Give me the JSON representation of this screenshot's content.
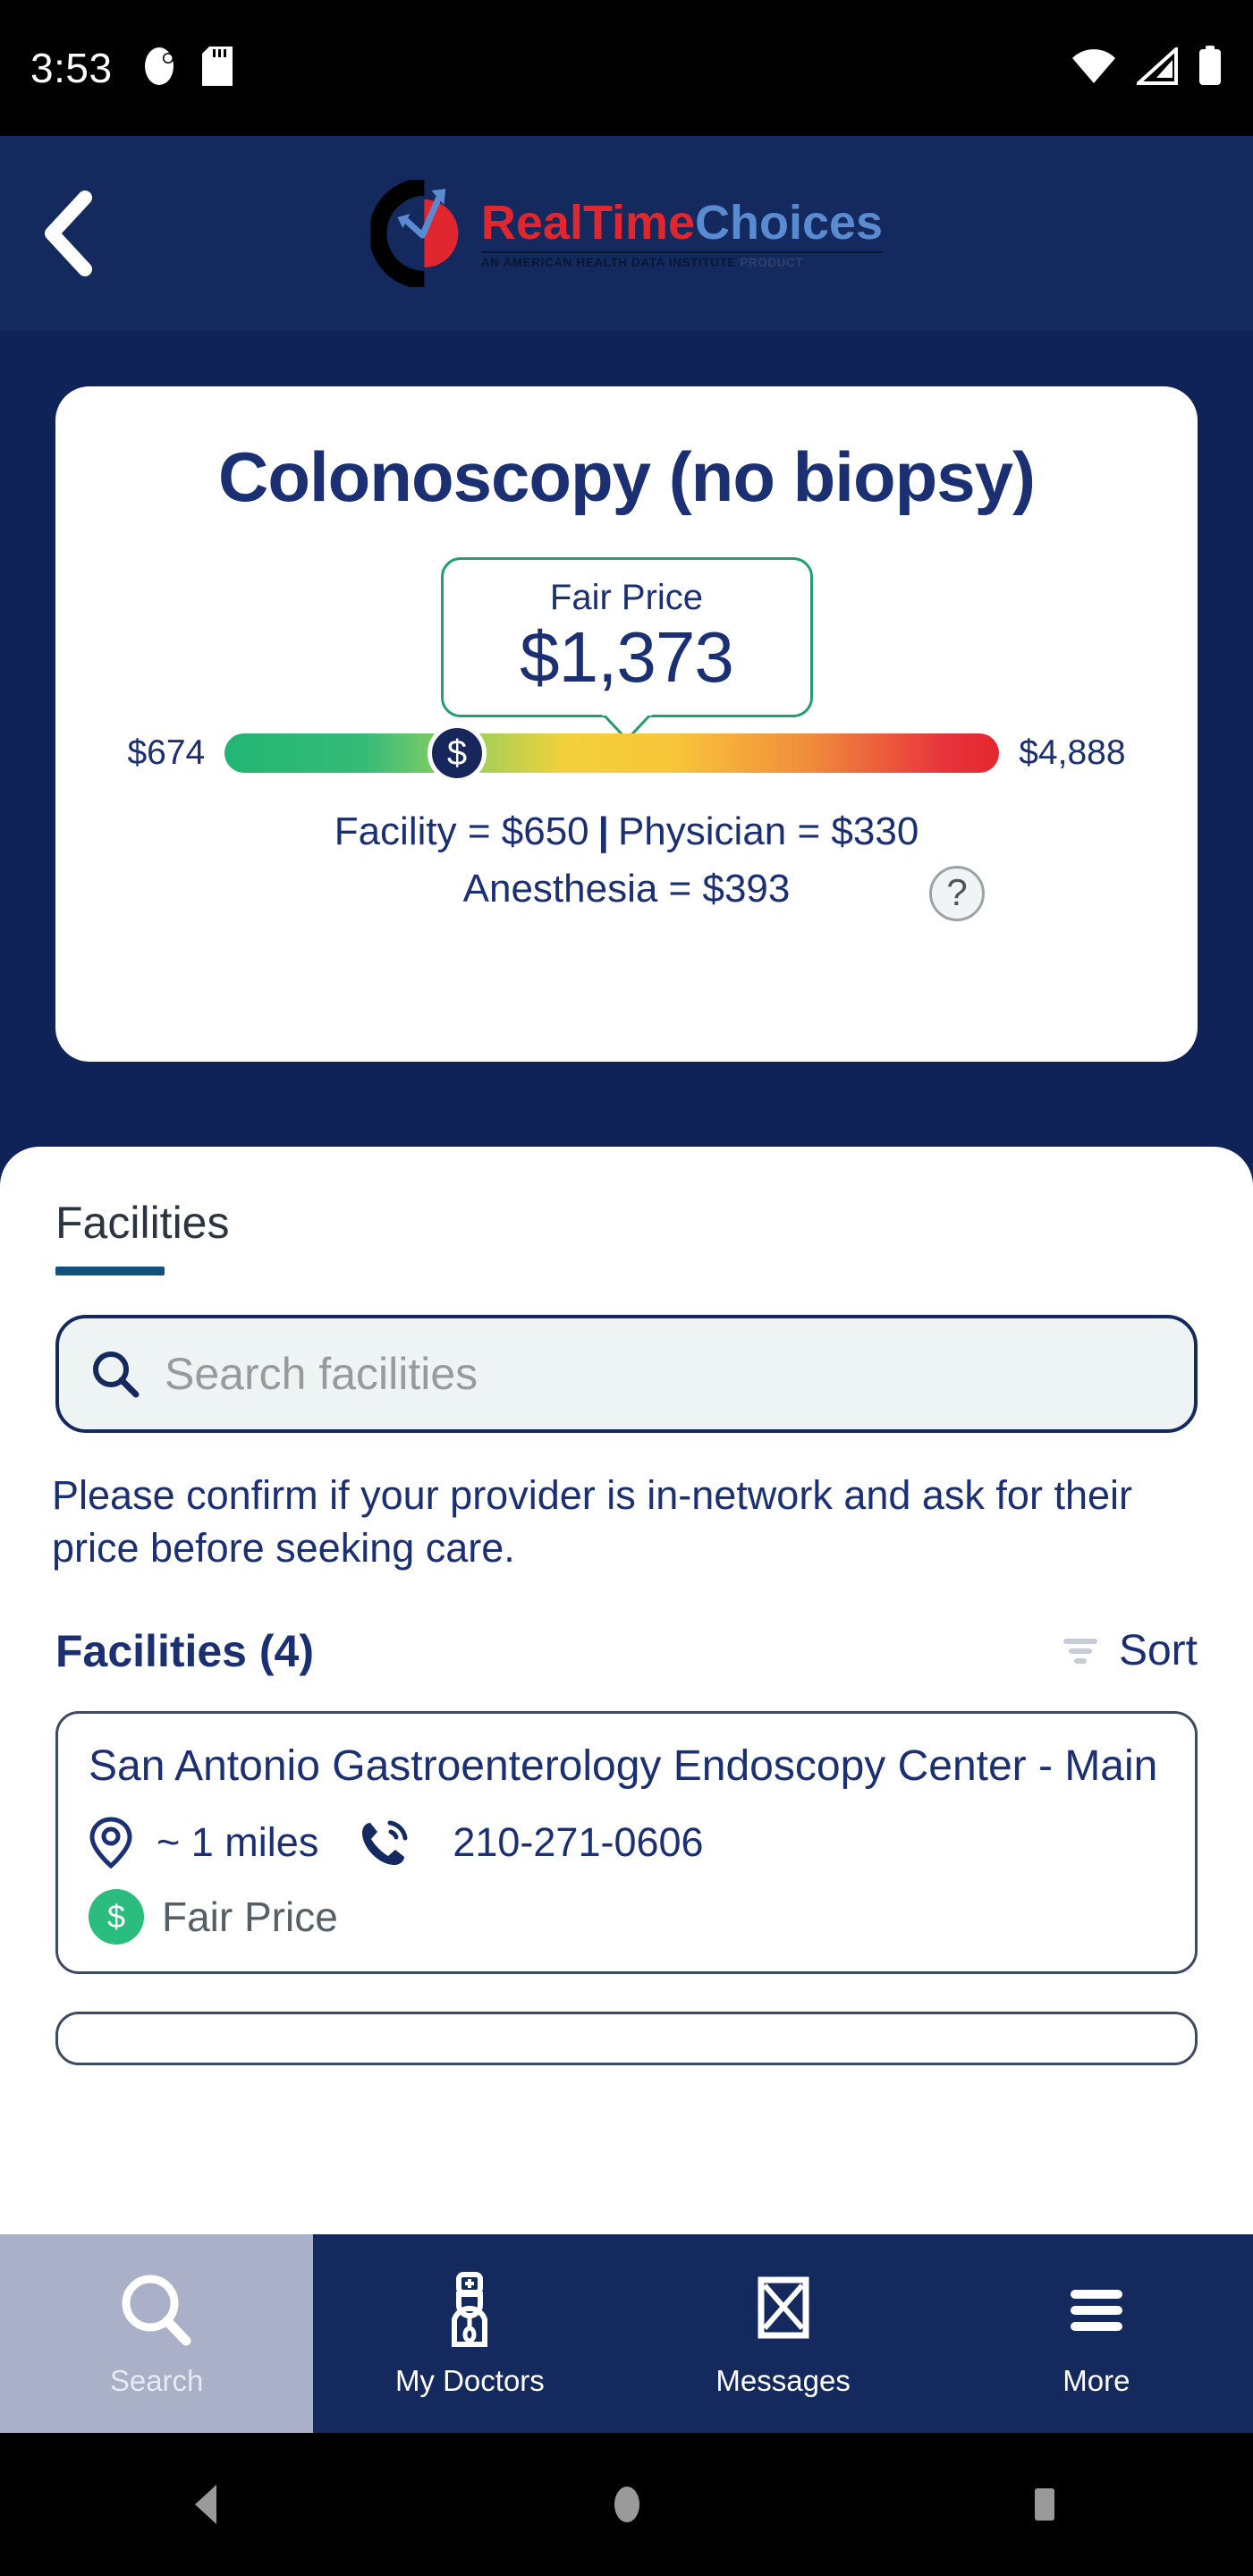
{
  "status_bar": {
    "time": "3:53",
    "left_icons": [
      "do-not-disturb-icon",
      "sd-card-icon"
    ],
    "right_icons": [
      "wifi-icon",
      "cellular-signal-icon",
      "battery-icon"
    ]
  },
  "header": {
    "back_icon": "chevron-left-icon",
    "logo": {
      "name_part1": "RealTime",
      "name_part2": "Choices",
      "tagline_bold": "AN AMERICAN HEALTH DATA INSTITUTE",
      "tagline_light": " PRODUCT",
      "mark_icon": "realtimechoices-logo-icon"
    },
    "background_color": "#14295d"
  },
  "hero": {
    "procedure_title": "Colonoscopy (no biopsy)",
    "fair_price_label": "Fair Price",
    "fair_price_value": "$1,373",
    "range_min": "$674",
    "range_max": "$4,888",
    "marker_symbol": "$",
    "marker_position_percent": 30,
    "breakdown_line1_part1": "Facility = $650",
    "breakdown_separator": "|",
    "breakdown_line1_part2": "Physician = $330",
    "breakdown_line2": "Anesthesia = $393",
    "help_icon_glyph": "?",
    "accent_green": "#22a06b",
    "navy": "#1b2f73"
  },
  "sheet": {
    "tab_label": "Facilities",
    "search": {
      "placeholder": "Search facilities",
      "value": "",
      "icon": "search-icon"
    },
    "disclaimer": "Please confirm if your provider is in-network and ask for their price before seeking care.",
    "list_header": {
      "title": "Facilities (4)",
      "sort_label": "Sort",
      "sort_icon": "sort-icon"
    },
    "facilities": [
      {
        "name": "San Antonio Gastroenterology Endoscopy Center - Main",
        "distance": "~ 1 miles",
        "distance_icon": "location-pin-icon",
        "phone": "210-271-0606",
        "phone_icon": "phone-icon",
        "price_tier": "Fair Price",
        "price_badge_symbol": "$",
        "price_badge_color": "#2bbd7e"
      }
    ]
  },
  "bottom_nav": {
    "items": [
      {
        "label": "Search",
        "icon": "search-icon",
        "active": true
      },
      {
        "label": "My Doctors",
        "icon": "doctor-icon",
        "active": false
      },
      {
        "label": "Messages",
        "icon": "envelope-icon",
        "active": false
      },
      {
        "label": "More",
        "icon": "hamburger-menu-icon",
        "active": false
      }
    ],
    "background_color": "#14295d",
    "active_background_color": "#a9b0c8"
  },
  "android_nav": {
    "back_icon": "android-back-icon",
    "home_icon": "android-home-icon",
    "recents_icon": "android-recents-icon"
  }
}
